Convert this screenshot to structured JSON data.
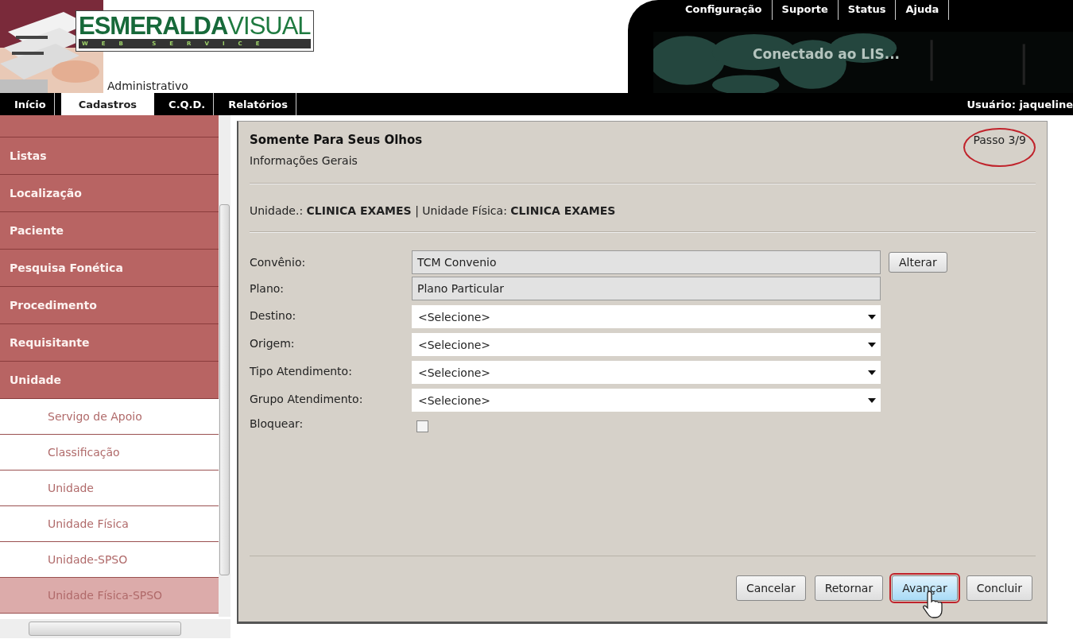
{
  "header": {
    "logo_main": "ESMERALDA",
    "logo_accent": "VISUAL",
    "logo_tagline": "WEB SERVICE",
    "module": "Administrativo",
    "top_links": [
      "Configuração",
      "Suporte",
      "Status",
      "Ajuda"
    ],
    "banner_text": "Conectado ao LIS..."
  },
  "nav": {
    "tabs": [
      {
        "label": "Início",
        "selected": false
      },
      {
        "label": "Cadastros",
        "selected": true
      },
      {
        "label": "C.Q.D.",
        "selected": false
      },
      {
        "label": "Relatórios",
        "selected": false
      }
    ],
    "user": "Usuário: jaqueline"
  },
  "sidebar": {
    "items": [
      {
        "label": "Listas",
        "selected": false
      },
      {
        "label": "Localização",
        "selected": false
      },
      {
        "label": "Paciente",
        "selected": false
      },
      {
        "label": "Pesquisa Fonética",
        "selected": false
      },
      {
        "label": "Procedimento",
        "selected": false
      },
      {
        "label": "Requisitante",
        "selected": false
      },
      {
        "label": "Unidade",
        "selected": false,
        "children": [
          {
            "label": "Servigo de Apoio",
            "selected": false
          },
          {
            "label": "Classificação",
            "selected": false
          },
          {
            "label": "Unidade",
            "selected": false
          },
          {
            "label": "Unidade Física",
            "selected": false
          },
          {
            "label": "Unidade-SPSO",
            "selected": false
          },
          {
            "label": "Unidade Física-SPSO",
            "selected": true
          }
        ]
      }
    ]
  },
  "panel": {
    "title": "Somente Para Seus Olhos",
    "subtitle": "Informações Gerais",
    "step": {
      "text": "Passo 3/9",
      "circled": true
    },
    "context": "Unidade.: **CLINICA EXAMES**  | Unidade Física: **CLINICA EXAMES**",
    "fields": [
      {
        "kind": "readonly",
        "label": "Convênio:",
        "value": "TCM Convenio",
        "button": "Alterar"
      },
      {
        "kind": "readonly",
        "label": "Plano:",
        "value": "Plano Particular"
      },
      {
        "kind": "select",
        "label": "Destino:",
        "value": "<Selecione>"
      },
      {
        "kind": "select",
        "label": "Origem:",
        "value": "<Selecione>"
      },
      {
        "kind": "select",
        "label": "Tipo Atendimento:",
        "value": "<Selecione>"
      },
      {
        "kind": "select",
        "label": "Grupo Atendimento:",
        "value": "<Selecione>"
      },
      {
        "kind": "checkbox",
        "label": "Bloquear:",
        "checked": false
      }
    ],
    "buttons": [
      {
        "label": "Cancelar",
        "highlighted": false,
        "hovered": false
      },
      {
        "label": "Retornar",
        "highlighted": false,
        "hovered": false
      },
      {
        "label": "Avançar",
        "highlighted": true,
        "hovered": true
      },
      {
        "label": "Concluir",
        "highlighted": false,
        "hovered": false
      }
    ]
  }
}
